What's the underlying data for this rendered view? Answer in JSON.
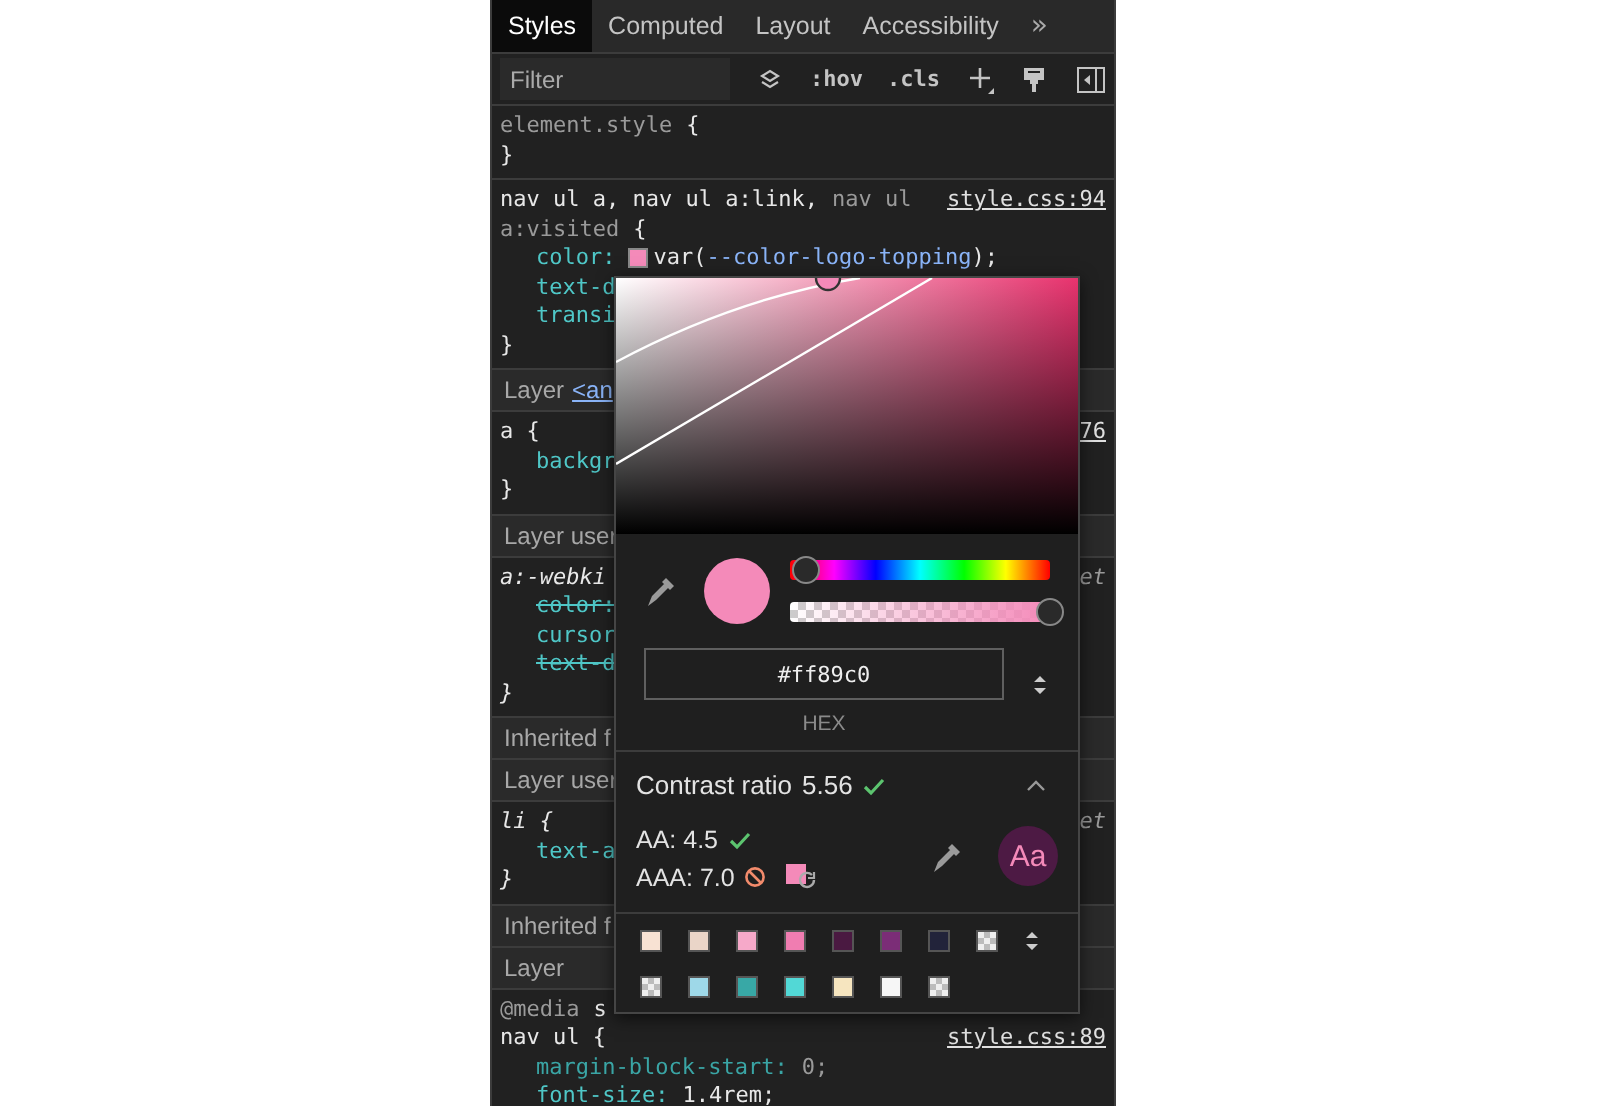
{
  "tabs": [
    {
      "label": "Styles",
      "selected": true
    },
    {
      "label": "Computed",
      "selected": false
    },
    {
      "label": "Layout",
      "selected": false
    },
    {
      "label": "Accessibility",
      "selected": false
    }
  ],
  "more_tabs": "»",
  "filter": {
    "placeholder": "Filter"
  },
  "toolbar": {
    "hov": ":hov",
    "cls": ".cls"
  },
  "blocks": [
    {
      "kind": "rule",
      "user_agent": false,
      "lines": [
        {
          "kind": "selector",
          "parts": [
            {
              "text": "element.style",
              "kind": "dim"
            },
            {
              "text": "{",
              "kind": "plain"
            }
          ]
        },
        {
          "kind": "close",
          "text": "}"
        }
      ]
    },
    {
      "kind": "rule",
      "user_agent": false,
      "lines": [
        {
          "kind": "selector",
          "source": {
            "text": "style.css:94",
            "link": true
          },
          "parts": [
            {
              "text": "nav ul a, nav ul a:link,",
              "kind": "plain"
            },
            {
              "text": "nav ul",
              "kind": "dim"
            }
          ]
        },
        {
          "kind": "selector",
          "parts": [
            {
              "text": "a:visited",
              "kind": "dim"
            },
            {
              "text": "{",
              "kind": "plain"
            }
          ]
        },
        {
          "kind": "decl",
          "property": "color:",
          "color": "#f48ab9",
          "value": [
            {
              "text": "var(",
              "kind": "plain"
            },
            {
              "text": "--color-logo-topping",
              "kind": "var"
            },
            {
              "text": ");",
              "kind": "plain"
            }
          ],
          "struck": false,
          "inactive": false
        },
        {
          "kind": "decl",
          "property": "text-d",
          "struck": false,
          "inactive": false
        },
        {
          "kind": "decl",
          "property": "transi",
          "struck": false,
          "inactive": false
        },
        {
          "kind": "close",
          "text": "}"
        }
      ]
    },
    {
      "kind": "header",
      "text": "Layer",
      "link": "<an"
    },
    {
      "kind": "rule",
      "user_agent": false,
      "lines": [
        {
          "kind": "selector",
          "source": {
            "text": "76",
            "link": true
          },
          "parts": [
            {
              "text": "a {",
              "kind": "plain"
            }
          ]
        },
        {
          "kind": "decl",
          "property": "backgr",
          "struck": false,
          "inactive": false
        },
        {
          "kind": "close",
          "text": "}"
        }
      ]
    },
    {
      "kind": "header",
      "text": "Layer user"
    },
    {
      "kind": "rule",
      "user_agent": true,
      "lines": [
        {
          "kind": "selector",
          "source": {
            "text": "et",
            "link": false
          },
          "parts": [
            {
              "text": "a:-webki",
              "kind": "plain"
            }
          ]
        },
        {
          "kind": "decl",
          "property": "color:",
          "struck": true,
          "inactive": false
        },
        {
          "kind": "decl",
          "property": "cursor",
          "struck": false,
          "inactive": false
        },
        {
          "kind": "decl",
          "property": "text-d",
          "struck": true,
          "inactive": false
        },
        {
          "kind": "close",
          "text": "}"
        }
      ]
    },
    {
      "kind": "header",
      "text": "Inherited f"
    },
    {
      "kind": "header",
      "text": "Layer user"
    },
    {
      "kind": "rule",
      "user_agent": true,
      "lines": [
        {
          "kind": "selector",
          "source": {
            "text": "et",
            "link": false
          },
          "parts": [
            {
              "text": "li {",
              "kind": "plain"
            }
          ]
        },
        {
          "kind": "decl",
          "property": "text-a",
          "struck": false,
          "inactive": false
        },
        {
          "kind": "close",
          "text": "}"
        }
      ]
    },
    {
      "kind": "header",
      "text": "Inherited f"
    },
    {
      "kind": "header",
      "text": "Layer"
    },
    {
      "kind": "rule",
      "user_agent": false,
      "lines": [
        {
          "kind": "selector",
          "parts": [
            {
              "text": "@media",
              "kind": "dim"
            },
            {
              "text": "s",
              "kind": "plain"
            }
          ]
        },
        {
          "kind": "selector",
          "source": {
            "text": "style.css:89",
            "link": true
          },
          "parts": [
            {
              "text": "nav ul {",
              "kind": "plain"
            }
          ]
        },
        {
          "kind": "decl",
          "property": "margin-block-start:",
          "value": [
            {
              "text": "0;",
              "kind": "dim"
            }
          ],
          "struck": false,
          "inactive": true
        },
        {
          "kind": "decl",
          "property": "font-size:",
          "value": [
            {
              "text": "1.4rem;",
              "kind": "plain"
            }
          ],
          "struck": false,
          "inactive": false
        }
      ]
    }
  ],
  "picker": {
    "hue": {
      "level": 0.06
    },
    "alpha": {
      "level": 1
    },
    "color": "#f48ab9",
    "hex": "#ff89c0",
    "format": "HEX",
    "contrast": {
      "label": "Contrast ratio",
      "value": "5.56",
      "passes": true,
      "expanded": true,
      "levels": [
        {
          "label": "AA: 4.5",
          "passes": true
        },
        {
          "label": "AAA: 7.0",
          "passes": false
        }
      ],
      "preview": "Aa"
    },
    "swatches": [
      {
        "kind": "color",
        "color": "#f8e2d3"
      },
      {
        "kind": "color",
        "color": "#ead5c8"
      },
      {
        "kind": "color",
        "color": "#f6a9c9"
      },
      {
        "kind": "color",
        "color": "#f07db1"
      },
      {
        "kind": "color",
        "color": "#4a1941"
      },
      {
        "kind": "color",
        "color": "#7b2d77"
      },
      {
        "kind": "color",
        "color": "#22233a"
      },
      {
        "kind": "checker"
      },
      {
        "kind": "checker"
      },
      {
        "kind": "color",
        "color": "#9ed8e8"
      },
      {
        "kind": "color",
        "color": "#38a8a6"
      },
      {
        "kind": "color",
        "color": "#52d8d6"
      },
      {
        "kind": "color",
        "color": "#f6e5bf"
      },
      {
        "kind": "color",
        "color": "#f6f6f6"
      },
      {
        "kind": "checker"
      }
    ]
  }
}
